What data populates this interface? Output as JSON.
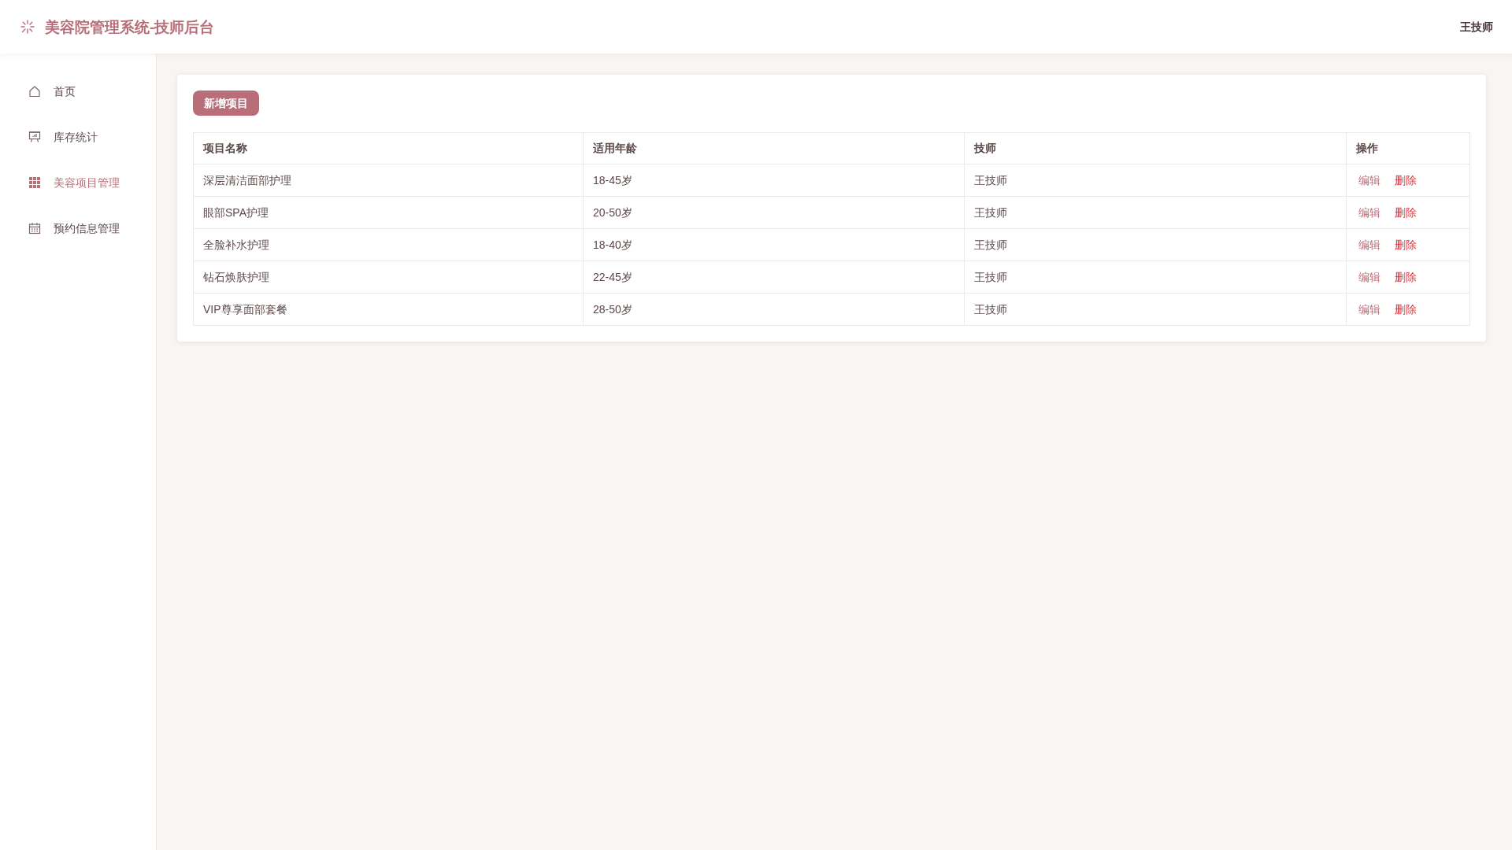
{
  "header": {
    "title": "美容院管理系统-技师后台",
    "user": "王技师"
  },
  "sidebar": {
    "items": [
      {
        "label": "首页",
        "selected": false
      },
      {
        "label": "库存统计",
        "selected": false
      },
      {
        "label": "美容项目管理",
        "selected": true
      },
      {
        "label": "预约信息管理",
        "selected": false
      }
    ]
  },
  "toolbar": {
    "add_button": "新增项目"
  },
  "table": {
    "columns": [
      "项目名称",
      "适用年龄",
      "技师",
      "操作"
    ],
    "rows": [
      {
        "cells": [
          "深层清洁面部护理",
          "18-45岁",
          "王技师"
        ],
        "actions": [
          {
            "label": "编辑",
            "kind": "edit"
          },
          {
            "label": "删除",
            "kind": "delete"
          }
        ]
      },
      {
        "cells": [
          "眼部SPA护理",
          "20-50岁",
          "王技师"
        ],
        "actions": [
          {
            "label": "编辑",
            "kind": "edit"
          },
          {
            "label": "删除",
            "kind": "delete"
          }
        ]
      },
      {
        "cells": [
          "全脸补水护理",
          "18-40岁",
          "王技师"
        ],
        "actions": [
          {
            "label": "编辑",
            "kind": "edit"
          },
          {
            "label": "删除",
            "kind": "delete"
          }
        ]
      },
      {
        "cells": [
          "钻石焕肤护理",
          "22-45岁",
          "王技师"
        ],
        "actions": [
          {
            "label": "编辑",
            "kind": "edit"
          },
          {
            "label": "删除",
            "kind": "delete"
          }
        ]
      },
      {
        "cells": [
          "VIP尊享面部套餐",
          "28-50岁",
          "王技师"
        ],
        "actions": [
          {
            "label": "编辑",
            "kind": "edit"
          },
          {
            "label": "删除",
            "kind": "delete"
          }
        ]
      }
    ]
  }
}
